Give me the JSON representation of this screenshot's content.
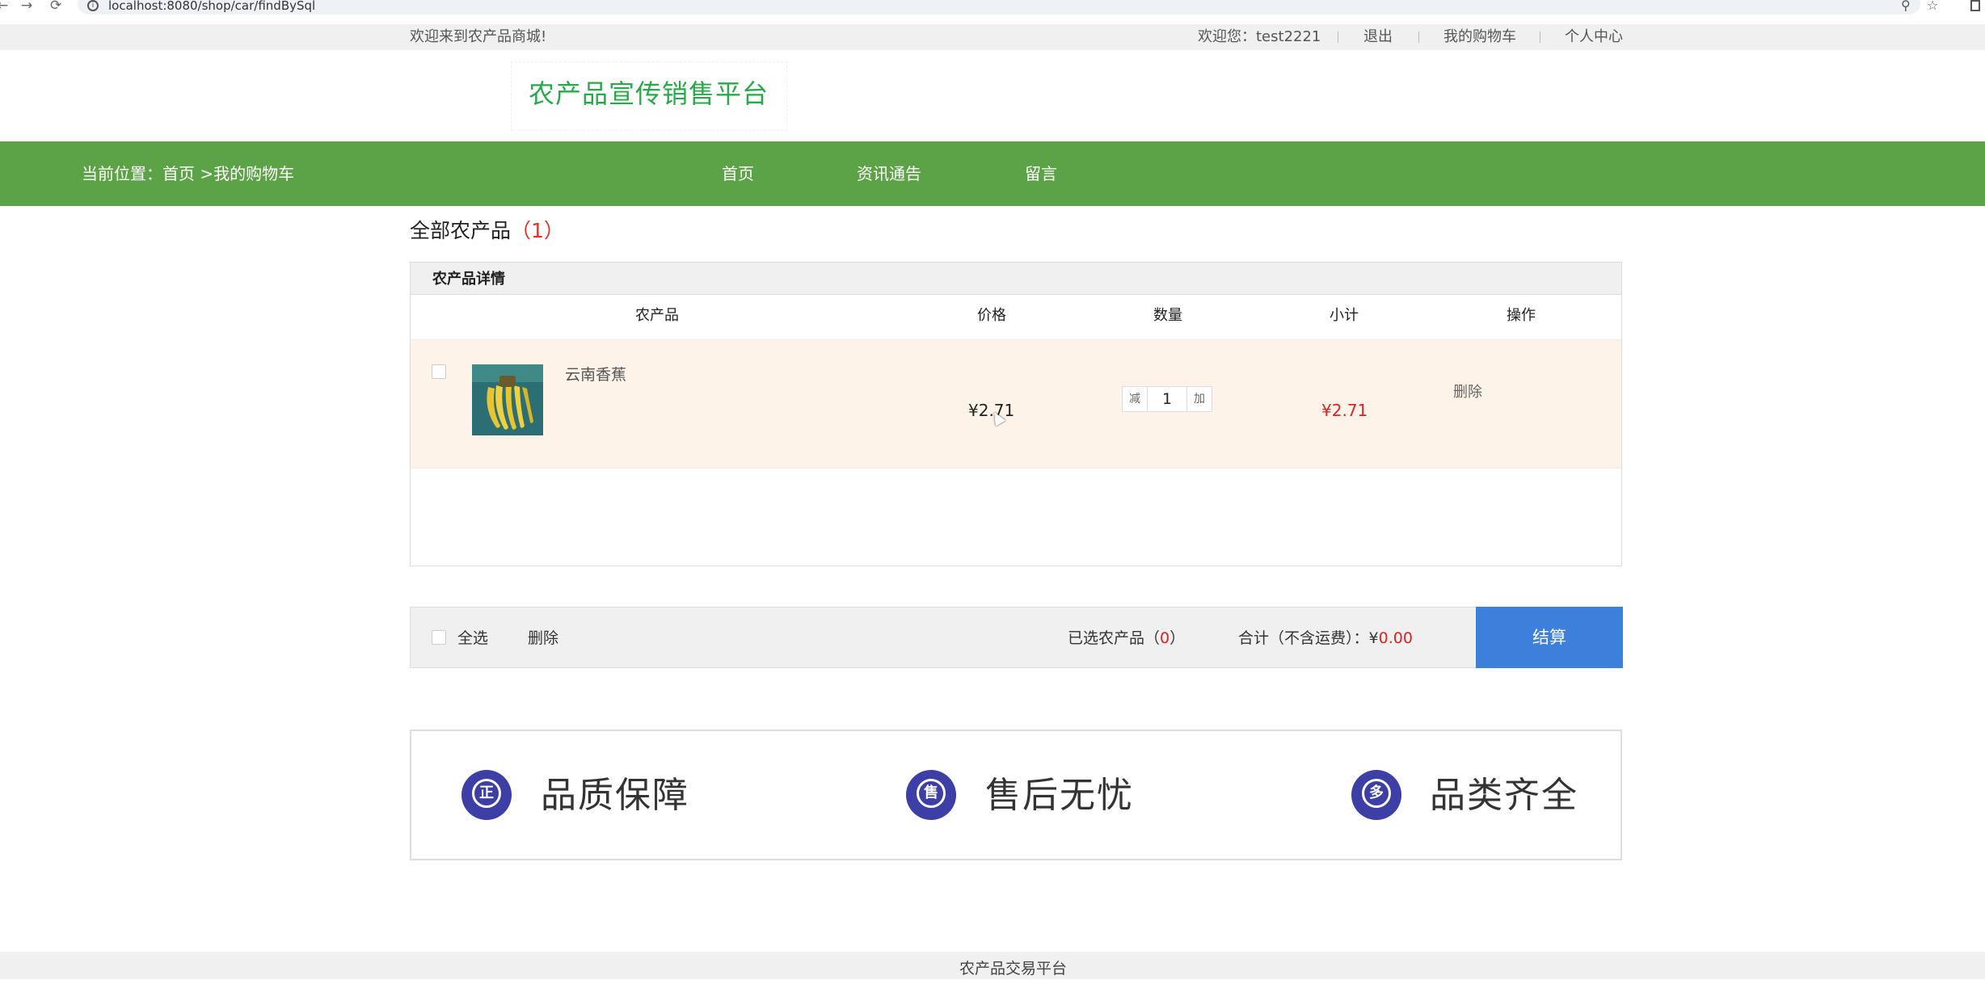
{
  "browser": {
    "url": "localhost:8080/shop/car/findBySql",
    "back_icon": "←",
    "forward_icon": "→",
    "reload_icon": "⟳",
    "zoom_icon": "⚲",
    "star_icon": "☆",
    "info_icon": "i"
  },
  "top_strip": {
    "welcome": "欢迎来到农产品商城!",
    "greeting": "欢迎您：test2221",
    "logout": "退出",
    "cart": "我的购物车",
    "profile": "个人中心"
  },
  "logo": {
    "title": "农产品宣传销售平台"
  },
  "nav": {
    "breadcrumb": "当前位置：首页 >我的购物车",
    "links": [
      "首页",
      "资讯通告",
      "留言"
    ]
  },
  "section": {
    "title": "全部农产品",
    "count": "（1）"
  },
  "cart": {
    "header": "农产品详情",
    "columns": [
      "农产品",
      "价格",
      "数量",
      "小计",
      "操作"
    ],
    "items": [
      {
        "name": "云南香蕉",
        "price": "¥2.71",
        "decrease": "减",
        "quantity": "1",
        "increase": "加",
        "subtotal": "¥2.71",
        "action": "删除"
      }
    ]
  },
  "bottom_bar": {
    "select_all": "全选",
    "delete": "删除",
    "selected_prefix": "已选农产品（",
    "selected_count": "0",
    "selected_suffix": "）",
    "total_label": "合计（不含运费）：",
    "currency": "¥",
    "total": "0.00",
    "checkout": "结算"
  },
  "features": [
    {
      "icon": "正",
      "label": "品质保障"
    },
    {
      "icon": "售",
      "label": "售后无忧"
    },
    {
      "icon": "多",
      "label": "品类齐全"
    }
  ],
  "footer": {
    "text": "农产品交易平台"
  },
  "colors": {
    "nav_green": "#5ba346",
    "logo_green": "#2aa94a",
    "price_red": "#dd2222",
    "checkout_blue": "#3d80dc",
    "feature_icon": "#3e3fa6",
    "row_highlight": "#fdf3e8"
  }
}
